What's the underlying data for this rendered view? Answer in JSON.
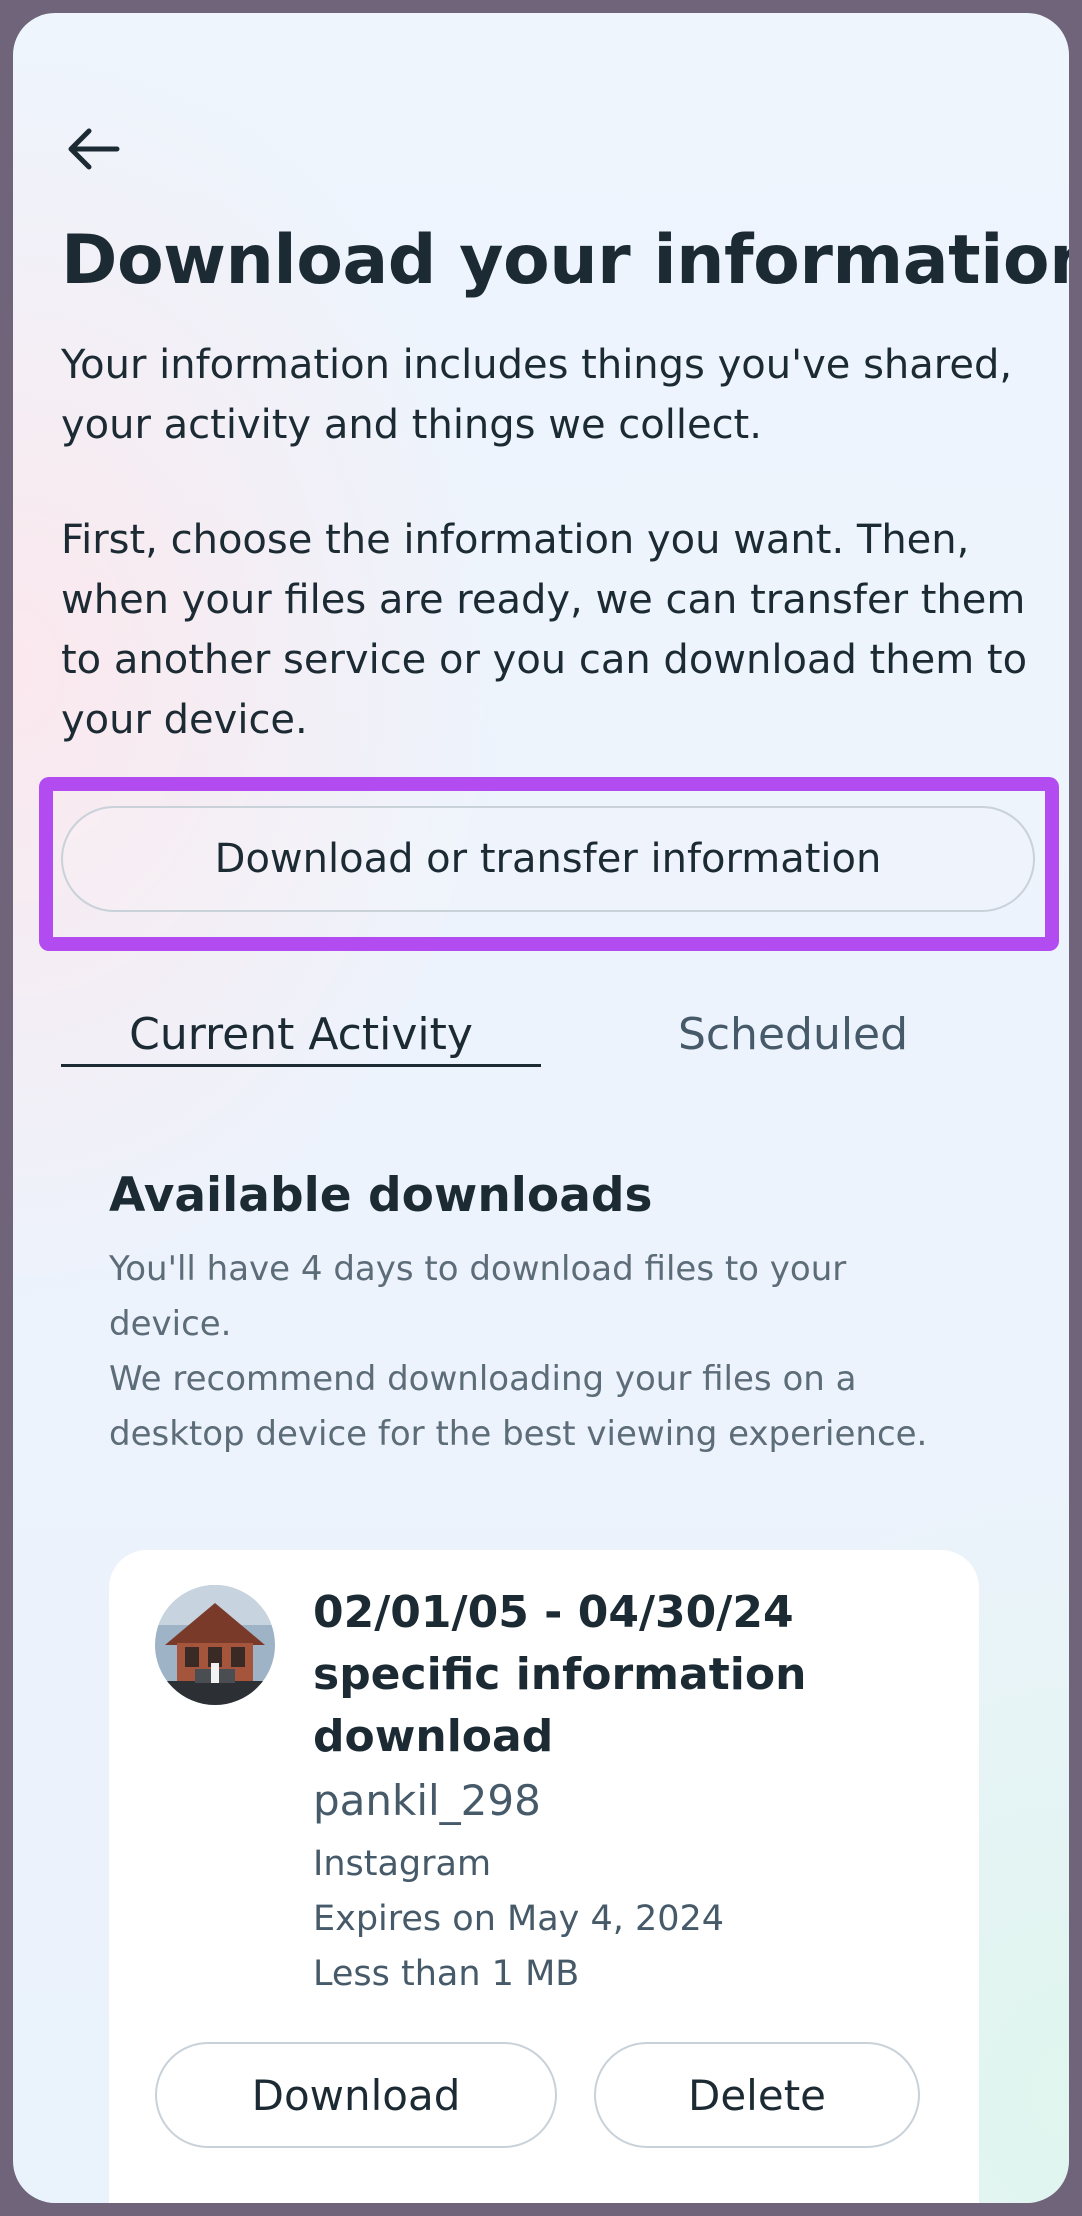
{
  "header": {
    "back_icon": "arrow-left-icon",
    "title": "Download your information"
  },
  "intro": {
    "paragraph1": "Your information includes things you've shared, your activity and things we collect.",
    "paragraph2": "First, choose the information you want. Then, when your files are ready, we can transfer them to another service or you can download them to your device."
  },
  "primary_button": {
    "label": "Download or transfer information",
    "highlight_color": "#b24cf0"
  },
  "tabs": [
    {
      "label": "Current Activity",
      "selected": true
    },
    {
      "label": "Scheduled",
      "selected": false
    }
  ],
  "downloads": {
    "title": "Available downloads",
    "subtitle1": "You'll have 4 days to download files to your device.",
    "subtitle2": "We recommend downloading your files on a desktop device for the best viewing experience.",
    "item": {
      "title": "02/01/05 - 04/30/24 specific information download",
      "username": "pankil_298",
      "platform": "Instagram",
      "expires": "Expires on May 4, 2024",
      "size": "Less than 1 MB",
      "download_label": "Download",
      "delete_label": "Delete"
    }
  },
  "colors": {
    "text_primary": "#1c2b33",
    "text_secondary": "#465a69",
    "border": "#c9d1d9"
  }
}
